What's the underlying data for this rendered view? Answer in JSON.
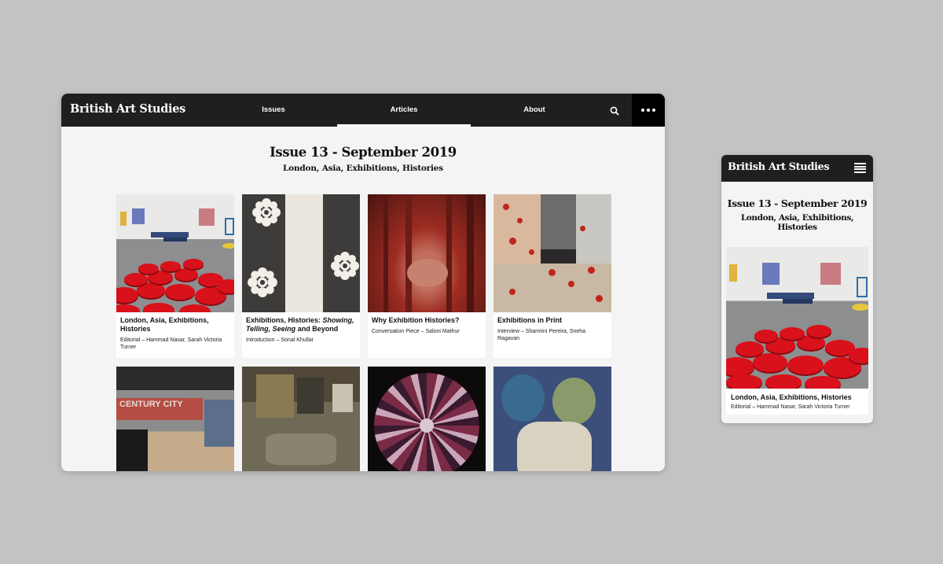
{
  "desktop": {
    "brand": "British Art Studies",
    "nav": {
      "issues": "Issues",
      "articles": "Articles",
      "about": "About"
    },
    "title": "Issue 13 - September 2019",
    "subtitle": "London, Asia, Exhibitions, Histories",
    "cards": [
      {
        "title": "London, Asia, Exhibitions, Histories",
        "meta": "Editorial – Hammad Nasar, Sarah Victoria Turner"
      },
      {
        "title_parts": [
          "Exhibitions, Histories: ",
          "Showing, Telling, Seeing",
          " and Beyond"
        ],
        "meta": "Introduction – Sonal Khullar"
      },
      {
        "title": "Why Exhibition Histories?",
        "meta": "Conversation Piece – Saloni Mathur"
      },
      {
        "title": "Exhibitions in Print",
        "meta": "Interview – Sharmini Pereira, Sneha Ragavan"
      }
    ],
    "second_row_image_text": "CENTURY CITY"
  },
  "mobile": {
    "brand": "British Art Studies",
    "title": "Issue 13 - September 2019",
    "subtitle": "London, Asia, Exhibitions, Histories",
    "card": {
      "title": "London, Asia, Exhibitions, Histories",
      "meta": "Editorial – Hammad Nasar, Sarah Victoria Turner"
    }
  },
  "icons": {
    "search": "search-icon",
    "more": "more-dots-icon",
    "menu": "hamburger-menu-icon"
  },
  "colors": {
    "nav": "#1f1f1f",
    "page": "#f4f4f4",
    "backdrop": "#c3c3c3",
    "accent_red": "#d8111b"
  }
}
